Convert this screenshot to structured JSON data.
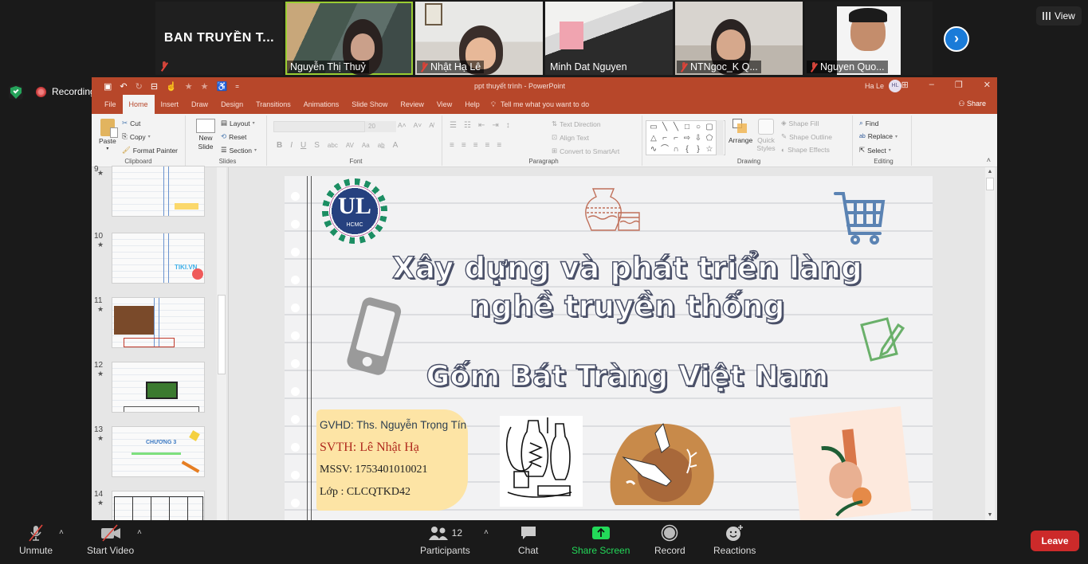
{
  "meeting": {
    "participants": [
      {
        "name": "BAN TRUYỀN T...",
        "muted": true,
        "video": false
      },
      {
        "name": "Nguyễn Thị Thuỷ",
        "muted": false,
        "video": true,
        "active_speaker": true
      },
      {
        "name": "Nhật Hạ Lê",
        "muted": true,
        "video": true
      },
      {
        "name": "Minh Dat Nguyen",
        "muted": false,
        "video": true
      },
      {
        "name": "NTNgoc_K Q...",
        "muted": true,
        "video": true
      },
      {
        "name": "Nguyen Quo...",
        "muted": true,
        "video": true
      }
    ],
    "next_page_icon": "chevron-right-icon",
    "view_label": "View",
    "security_icon": "shield-check-icon",
    "recording_label": "Recording"
  },
  "powerpoint": {
    "title": "ppt thuyết trình  -  PowerPoint",
    "user_name": "Ha Le",
    "user_initials": "HL",
    "window_controls": [
      "restore-ribbon",
      "minimize",
      "maximize",
      "close"
    ],
    "tabs": [
      "File",
      "Home",
      "Insert",
      "Draw",
      "Design",
      "Transitions",
      "Animations",
      "Slide Show",
      "Review",
      "View",
      "Help"
    ],
    "active_tab": "Home",
    "tell_me": "Tell me what you want to do",
    "share_label": "Share",
    "ribbon": {
      "clipboard": {
        "name": "Clipboard",
        "paste": "Paste",
        "cut": "Cut",
        "copy": "Copy",
        "format_painter": "Format Painter"
      },
      "slides": {
        "name": "Slides",
        "new_slide": "New Slide",
        "layout": "Layout",
        "reset": "Reset",
        "section": "Section"
      },
      "font": {
        "name": "Font",
        "font_size": "20",
        "bold": "B",
        "italic": "I",
        "underline": "U",
        "strike": "S",
        "abc": "abc",
        "spacing": "AV",
        "case": "Aa",
        "color": "A"
      },
      "paragraph": {
        "name": "Paragraph",
        "text_direction": "Text Direction",
        "align_text": "Align Text",
        "convert_smartart": "Convert to SmartArt"
      },
      "drawing": {
        "name": "Drawing",
        "arrange": "Arrange",
        "quick_styles": "Quick Styles",
        "shape_fill": "Shape Fill",
        "shape_outline": "Shape Outline",
        "shape_effects": "Shape Effects"
      },
      "editing": {
        "name": "Editing",
        "find": "Find",
        "replace": "Replace",
        "select": "Select"
      }
    },
    "thumbnails": [
      {
        "number": "9"
      },
      {
        "number": "10"
      },
      {
        "number": "11"
      },
      {
        "number": "12"
      },
      {
        "number": "13",
        "caption": "CHƯƠNG 3"
      },
      {
        "number": "14"
      }
    ],
    "slide": {
      "title_line1": "Xây dựng và phát triển làng",
      "title_line2": "nghề truyền thống",
      "subtitle": "Gốm Bát Tràng Việt Nam",
      "logo_text": "UL",
      "logo_sub": "HCMC",
      "gvhd": "GVHD: Ths. Nguyễn Trọng Tín",
      "svth": "SVTH: Lê Nhật Hạ",
      "mssv": "MSSV: 1753401010021",
      "lop": "Lớp : CLCQTKD42"
    }
  },
  "toolbar": {
    "unmute": "Unmute",
    "start_video": "Start Video",
    "participants": "Participants",
    "participants_count": "12",
    "chat": "Chat",
    "share_screen": "Share Screen",
    "record": "Record",
    "reactions": "Reactions",
    "leave": "Leave",
    "share_color": "#23d959",
    "leave_color": "#cc2a2a"
  }
}
